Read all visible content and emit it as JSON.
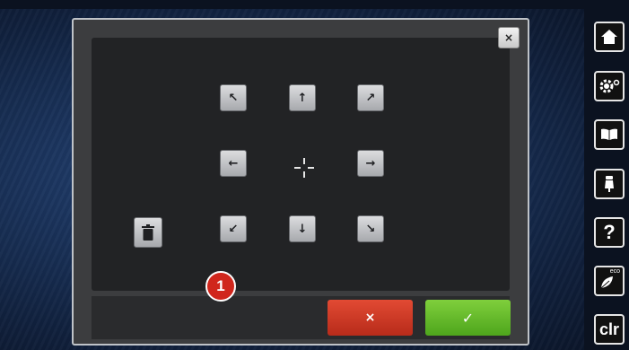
{
  "dialog": {
    "close_label": "×",
    "delete_label": "",
    "callout_number": "1",
    "cancel_label": "×",
    "confirm_label": "✓"
  },
  "move_buttons": {
    "up_left": "↖",
    "up": "↑",
    "up_right": "↗",
    "left": "←",
    "right": "→",
    "down_left": "↙",
    "down": "↓",
    "down_right": "↘"
  },
  "sidebar": {
    "help_label": "?",
    "eco_label": "eco",
    "clear_label": "clr"
  },
  "colors": {
    "cancel": "#c93a25",
    "confirm": "#66bb2a",
    "callout": "#d0261c"
  }
}
